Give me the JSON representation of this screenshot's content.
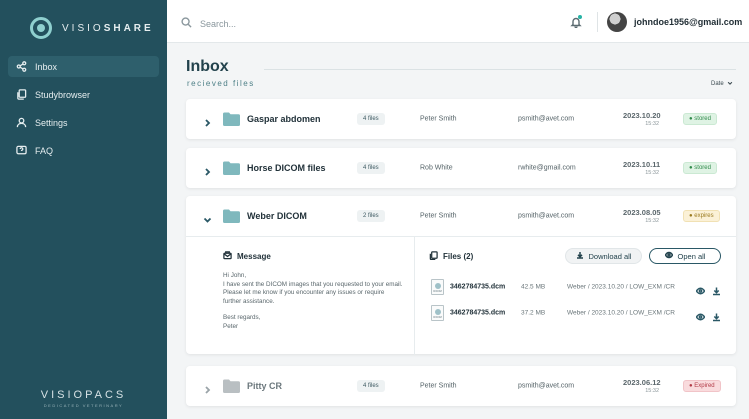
{
  "app": {
    "logo_prefix": "VISIO",
    "logo_suffix": "SHARE",
    "footer_brand": "VISIOPACS",
    "footer_tagline": "DEDICATED VETERINARY"
  },
  "sidebar": {
    "items": [
      {
        "label": "Inbox",
        "icon": "share-icon"
      },
      {
        "label": "Studybrowser",
        "icon": "copy-icon"
      },
      {
        "label": "Settings",
        "icon": "user-icon"
      },
      {
        "label": "FAQ",
        "icon": "question-icon"
      }
    ]
  },
  "header": {
    "search_placeholder": "Search...",
    "user_email": "johndoe1956@gmail.com"
  },
  "page": {
    "title": "Inbox",
    "subtitle": "recieved files",
    "sort_label": "Date"
  },
  "rows": [
    {
      "name": "Gaspar abdomen",
      "count": "4 files",
      "sender": "Peter Smith",
      "email": "psmith@avet.com",
      "date": "2023.10.20",
      "time": "15:32",
      "status": "stored"
    },
    {
      "name": "Horse DICOM files",
      "count": "4 files",
      "sender": "Rob White",
      "email": "rwhite@gmail.com",
      "date": "2023.10.11",
      "time": "15:32",
      "status": "stored"
    },
    {
      "name": "Weber DICOM",
      "count": "2 files",
      "sender": "Peter Smith",
      "email": "psmith@avet.com",
      "date": "2023.08.05",
      "time": "15:32",
      "status": "expires"
    },
    {
      "name": "Pitty CR",
      "count": "4 files",
      "sender": "Peter Smith",
      "email": "psmith@avet.com",
      "date": "2023.06.12",
      "time": "15:32",
      "status": "Expired"
    }
  ],
  "expanded": {
    "message_title": "Message",
    "message_greeting": "Hi John,",
    "message_body": "I have sent the DICOM images that you requested to your email.  Please let me know if you encounter any issues or require further assistance.",
    "message_regards": "Best regards,",
    "message_sign": "Peter",
    "files_title": "Files (2)",
    "download_all": "Download all",
    "open_all": "Open all",
    "files": [
      {
        "name": "3462784735.dcm",
        "size": "42.5 MB",
        "path": "Weber / 2023.10.20 / LOW_EXM /CR"
      },
      {
        "name": "3462784735.dcm",
        "size": "37.2 MB",
        "path": "Weber / 2023.10.20 / LOW_EXM /CR"
      }
    ]
  },
  "colors": {
    "sidebar": "#23505d",
    "accent": "#2a5866",
    "folder": "#7fb8bd",
    "folder_disabled": "#b9bfc2"
  }
}
